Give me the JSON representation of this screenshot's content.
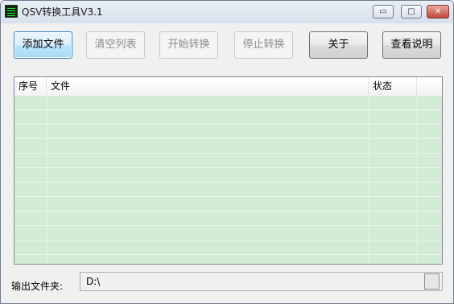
{
  "window": {
    "title": "QSV转换工具V3.1",
    "controls": {
      "minimize": "▭",
      "maximize": "□",
      "close": "✕"
    }
  },
  "toolbar": {
    "add_file": "添加文件",
    "clear_list": "清空列表",
    "start_convert": "开始转换",
    "stop_convert": "停止转换",
    "about": "关于",
    "view_help": "查看说明"
  },
  "file_list": {
    "columns": [
      "序号",
      "文件",
      "状态"
    ],
    "rows": []
  },
  "output": {
    "label": "输出文件夹:",
    "path": "D:\\"
  },
  "colors": {
    "list_background": "#d3ead4",
    "focused_button": "#bee6fd"
  }
}
